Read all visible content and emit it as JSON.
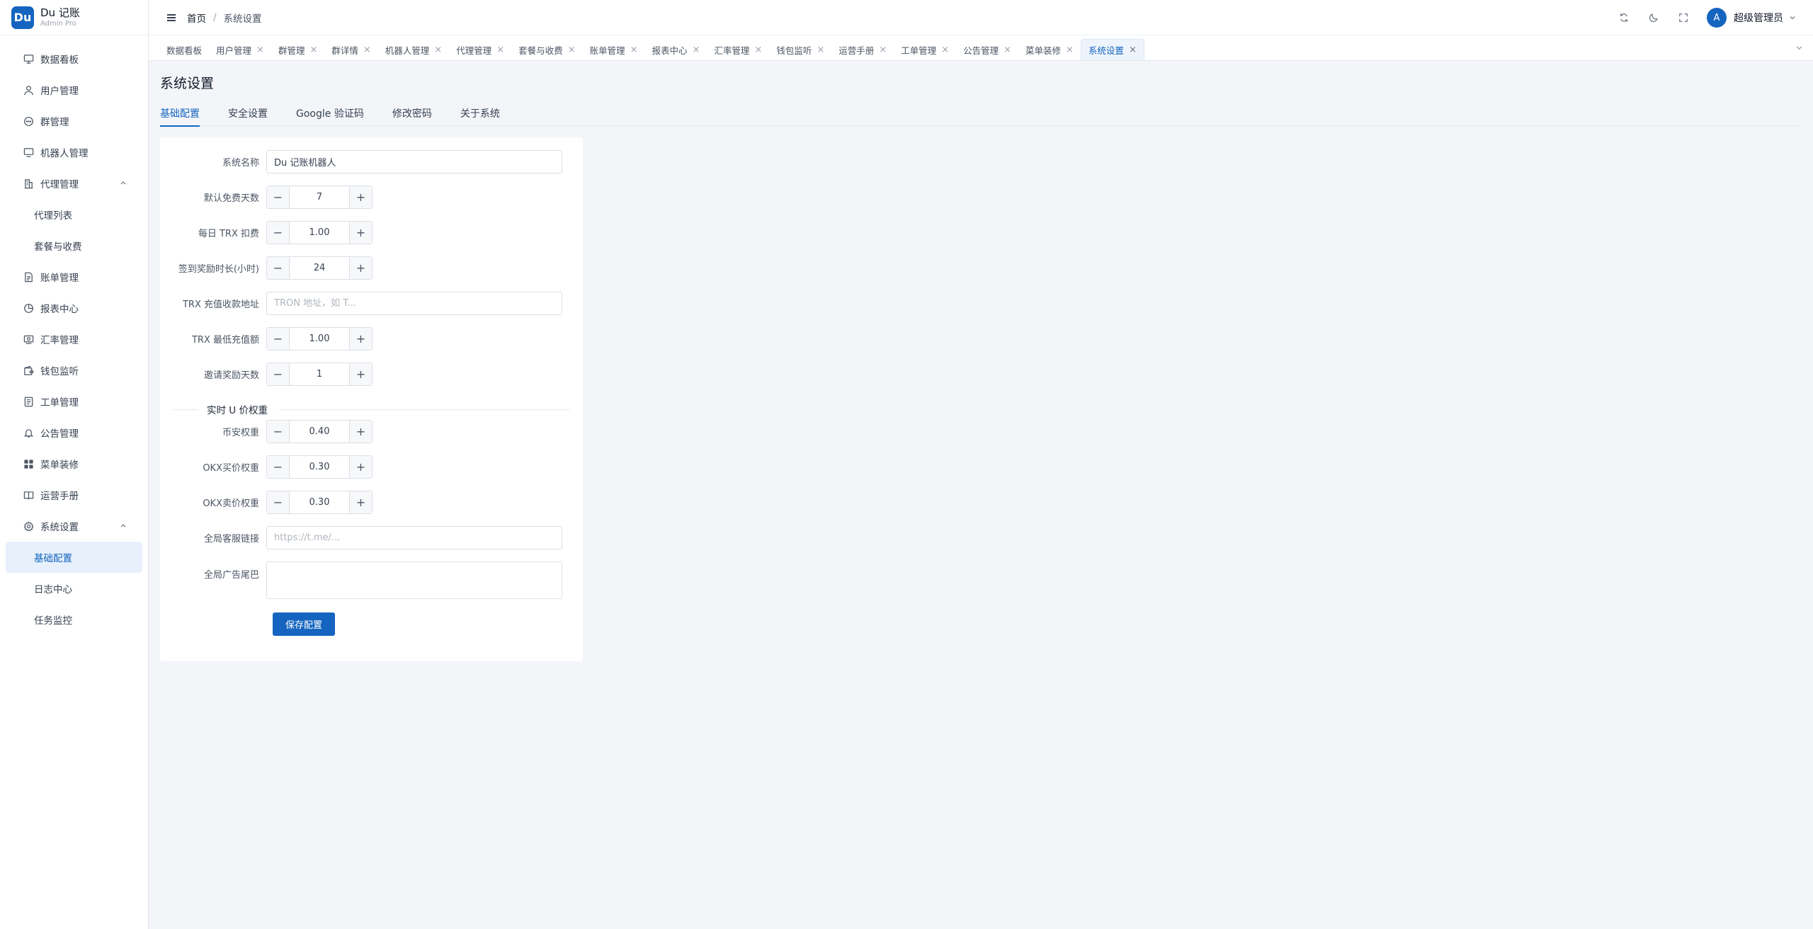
{
  "app": {
    "logo_badge": "Du",
    "title": "Du 记账",
    "subtitle": "Admin Pro"
  },
  "sidebar": {
    "items": [
      {
        "label": "数据看板",
        "icon": "dashboard-icon"
      },
      {
        "label": "用户管理",
        "icon": "user-icon"
      },
      {
        "label": "群管理",
        "icon": "chat-icon"
      },
      {
        "label": "机器人管理",
        "icon": "monitor-icon"
      },
      {
        "label": "代理管理",
        "icon": "building-icon",
        "expanded": true
      },
      {
        "label": "代理列表",
        "sub": true
      },
      {
        "label": "套餐与收费",
        "sub": true
      },
      {
        "label": "账单管理",
        "icon": "document-icon"
      },
      {
        "label": "报表中心",
        "icon": "pie-chart-icon"
      },
      {
        "label": "汇率管理",
        "icon": "exchange-icon"
      },
      {
        "label": "钱包监听",
        "icon": "wallet-icon"
      },
      {
        "label": "工单管理",
        "icon": "ticket-icon"
      },
      {
        "label": "公告管理",
        "icon": "bell-icon"
      },
      {
        "label": "菜单装修",
        "icon": "grid-icon"
      },
      {
        "label": "运营手册",
        "icon": "book-icon"
      },
      {
        "label": "系统设置",
        "icon": "gear-icon",
        "expanded": true
      },
      {
        "label": "基础配置",
        "sub": true,
        "active": true
      },
      {
        "label": "日志中心",
        "sub": true
      },
      {
        "label": "任务监控",
        "sub": true
      }
    ]
  },
  "header": {
    "breadcrumb_home": "首页",
    "breadcrumb_sep": "/",
    "breadcrumb_current": "系统设置",
    "user_initial": "A",
    "user_name": "超级管理员"
  },
  "tabs": [
    {
      "label": "数据看板",
      "closable": false
    },
    {
      "label": "用户管理",
      "closable": true
    },
    {
      "label": "群管理",
      "closable": true
    },
    {
      "label": "群详情",
      "closable": true
    },
    {
      "label": "机器人管理",
      "closable": true
    },
    {
      "label": "代理管理",
      "closable": true
    },
    {
      "label": "套餐与收费",
      "closable": true
    },
    {
      "label": "账单管理",
      "closable": true
    },
    {
      "label": "报表中心",
      "closable": true
    },
    {
      "label": "汇率管理",
      "closable": true
    },
    {
      "label": "钱包监听",
      "closable": true
    },
    {
      "label": "运营手册",
      "closable": true
    },
    {
      "label": "工单管理",
      "closable": true
    },
    {
      "label": "公告管理",
      "closable": true
    },
    {
      "label": "菜单装修",
      "closable": true
    },
    {
      "label": "系统设置",
      "closable": true,
      "active": true
    }
  ],
  "page": {
    "title": "系统设置",
    "subtabs": [
      "基础配置",
      "安全设置",
      "Google 验证码",
      "修改密码",
      "关于系统"
    ]
  },
  "form": {
    "system_name": {
      "label": "系统名称",
      "value": "Du 记账机器人"
    },
    "free_days": {
      "label": "默认免费天数",
      "value": "7"
    },
    "daily_trx": {
      "label": "每日 TRX 扣费",
      "value": "1.00"
    },
    "checkin_hours": {
      "label": "签到奖励时长(小时)",
      "value": "24"
    },
    "trx_address": {
      "label": "TRX 充值收款地址",
      "placeholder": "TRON 地址，如 T..."
    },
    "trx_min": {
      "label": "TRX 最低充值额",
      "value": "1.00"
    },
    "invite_days": {
      "label": "邀请奖励天数",
      "value": "1"
    },
    "section_title": "实时 U 价权重",
    "binance_weight": {
      "label": "币安权重",
      "value": "0.40"
    },
    "okx_buy_weight": {
      "label": "OKX买价权重",
      "value": "0.30"
    },
    "okx_sell_weight": {
      "label": "OKX卖价权重",
      "value": "0.30"
    },
    "support_link": {
      "label": "全局客服链接",
      "placeholder": "https://t.me/..."
    },
    "ad_tail": {
      "label": "全局广告尾巴",
      "value": ""
    },
    "save_label": "保存配置"
  }
}
